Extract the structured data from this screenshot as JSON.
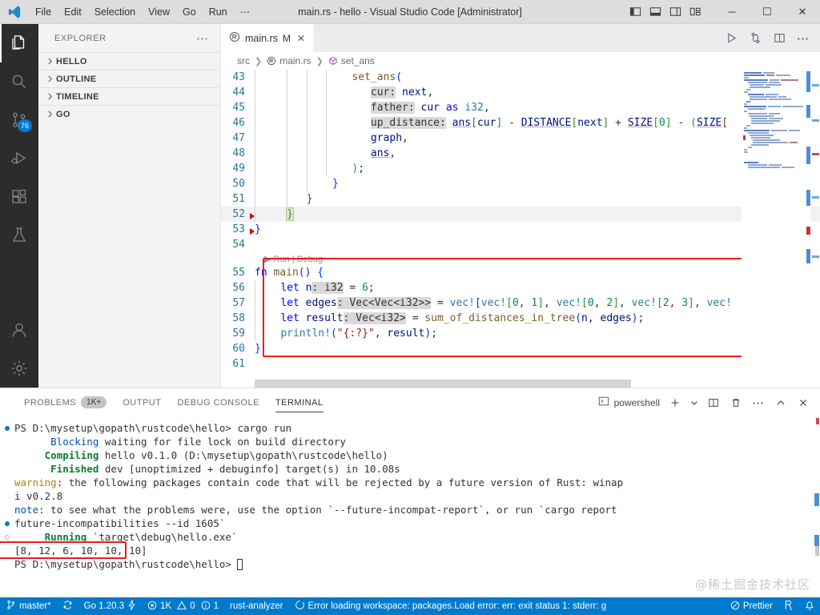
{
  "titlebar": {
    "title": "main.rs - hello - Visual Studio Code [Administrator]",
    "menu": [
      "File",
      "Edit",
      "Selection",
      "View",
      "Go",
      "Run",
      "⋯"
    ],
    "layout_icons": [
      "toggle-primary-sidebar-icon",
      "toggle-panel-icon",
      "toggle-secondary-sidebar-icon",
      "customize-layout-icon"
    ],
    "window_controls": {
      "minimize": "─",
      "maximize": "☐",
      "close": "✕"
    }
  },
  "activitybar": {
    "items": [
      {
        "name": "explorer",
        "badge": ""
      },
      {
        "name": "search",
        "badge": ""
      },
      {
        "name": "source-control",
        "badge": "76"
      },
      {
        "name": "run-and-debug",
        "badge": ""
      },
      {
        "name": "extensions",
        "badge": ""
      },
      {
        "name": "testing",
        "badge": ""
      }
    ],
    "bottom": [
      {
        "name": "accounts"
      },
      {
        "name": "settings"
      }
    ]
  },
  "sidebar": {
    "header": "EXPLORER",
    "more_label": "⋯",
    "sections": [
      {
        "label": "HELLO",
        "expanded": false
      },
      {
        "label": "OUTLINE",
        "expanded": false
      },
      {
        "label": "TIMELINE",
        "expanded": false
      },
      {
        "label": "GO",
        "expanded": false
      }
    ]
  },
  "editor": {
    "tab": {
      "label": "main.rs",
      "dirty_indicator": "M",
      "close": "✕"
    },
    "actions": [
      "run-code-icon",
      "split-changes-icon",
      "split-editor-icon",
      "more-actions-icon"
    ],
    "breadcrumb": [
      "src",
      "main.rs",
      "set_ans"
    ],
    "codelens": "▶ Run | Debug",
    "first_line_number": 43,
    "lines": [
      {
        "n": 43,
        "text": "            set_ans("
      },
      {
        "n": 44,
        "text": "                cur: next,"
      },
      {
        "n": 45,
        "text": "                father: cur as i32,"
      },
      {
        "n": 46,
        "text": "                up_distance: ans[cur] - DISTANCE[next] + SIZE[0] - (SIZE["
      },
      {
        "n": 47,
        "text": "                graph,"
      },
      {
        "n": 48,
        "text": "                ans,"
      },
      {
        "n": 49,
        "text": "            );"
      },
      {
        "n": 50,
        "text": "        }"
      },
      {
        "n": 51,
        "text": "    }"
      },
      {
        "n": 52,
        "text": "}"
      },
      {
        "n": 53,
        "text": "}"
      },
      {
        "n": 54,
        "text": ""
      },
      {
        "n": 55,
        "text": "fn main() {"
      },
      {
        "n": 56,
        "text": "    let n: i32 = 6;"
      },
      {
        "n": 57,
        "text": "    let edges: Vec<Vec<i32>> = vec![vec![0, 1], vec![0, 2], vec![2, 3], vec!"
      },
      {
        "n": 58,
        "text": "    let result: Vec<i32> = sum_of_distances_in_tree(n, edges);"
      },
      {
        "n": 59,
        "text": "    println!(\"{:?}\", result);"
      },
      {
        "n": 60,
        "text": "}"
      },
      {
        "n": 61,
        "text": ""
      }
    ],
    "highlight_box_color": "#ef1b1b"
  },
  "panel": {
    "tabs": [
      {
        "label": "PROBLEMS",
        "badge": "1K+",
        "active": false
      },
      {
        "label": "OUTPUT",
        "badge": "",
        "active": false
      },
      {
        "label": "DEBUG CONSOLE",
        "badge": "",
        "active": false
      },
      {
        "label": "TERMINAL",
        "badge": "",
        "active": true
      }
    ],
    "terminal_selector": "powershell",
    "actions": [
      "new-terminal-icon",
      "terminal-dropdown-icon",
      "split-terminal-icon",
      "kill-terminal-icon",
      "more-actions-icon",
      "maximize-panel-icon",
      "close-panel-icon"
    ],
    "terminal_lines": [
      {
        "segments": [
          {
            "t": "PS D:\\mysetup\\gopath\\rustcode\\hello> cargo run",
            "c": "plain"
          }
        ],
        "dot": "solid"
      },
      {
        "segments": [
          {
            "t": "      ",
            "c": "plain"
          },
          {
            "t": "Blocking",
            "c": "blue"
          },
          {
            "t": " waiting for file lock on build directory",
            "c": "plain"
          }
        ],
        "dot": ""
      },
      {
        "segments": [
          {
            "t": "     ",
            "c": "plain"
          },
          {
            "t": "Compiling",
            "c": "green"
          },
          {
            "t": " hello v0.1.0 (D:\\mysetup\\gopath\\rustcode\\hello)",
            "c": "plain"
          }
        ],
        "dot": ""
      },
      {
        "segments": [
          {
            "t": "      ",
            "c": "plain"
          },
          {
            "t": "Finished",
            "c": "green"
          },
          {
            "t": " dev [unoptimized + debuginfo] target(s) in 10.08s",
            "c": "plain"
          }
        ],
        "dot": ""
      },
      {
        "segments": [
          {
            "t": "warning",
            "c": "warn"
          },
          {
            "t": ": the following packages contain code that will be rejected by a future version of Rust: winap",
            "c": "plain"
          }
        ],
        "dot": ""
      },
      {
        "segments": [
          {
            "t": "i v0.2.8",
            "c": "plain"
          }
        ],
        "dot": ""
      },
      {
        "segments": [
          {
            "t": "note",
            "c": "note"
          },
          {
            "t": ": to see what the problems were, use the option `--future-incompat-report`, or run `cargo report",
            "c": "plain"
          }
        ],
        "dot": ""
      },
      {
        "segments": [
          {
            "t": "future-incompatibilities --id 1605`",
            "c": "plain"
          }
        ],
        "dot": "solid"
      },
      {
        "segments": [
          {
            "t": "     ",
            "c": "plain"
          },
          {
            "t": "Running",
            "c": "green"
          },
          {
            "t": " `target\\debug\\hello.exe`",
            "c": "plain"
          }
        ],
        "dot": "hollow"
      },
      {
        "segments": [
          {
            "t": "[8, 12, 6, 10, 10, 10]",
            "c": "plain"
          }
        ],
        "dot": ""
      },
      {
        "segments": [
          {
            "t": "PS D:\\mysetup\\gopath\\rustcode\\hello> ",
            "c": "plain"
          },
          {
            "t": "█",
            "c": "cursor"
          }
        ],
        "dot": ""
      }
    ],
    "watermark": "@稀土掘金技术社区"
  },
  "statusbar": {
    "background": "#007acc",
    "left": [
      {
        "name": "remote-branch",
        "icon": "source-control-icon",
        "label": "master*"
      },
      {
        "name": "sync-changes",
        "icon": "sync-icon",
        "label": ""
      },
      {
        "name": "go-version",
        "icon": "",
        "label": "Go 1.20.3"
      },
      {
        "name": "go-lightning",
        "icon": "lightning-icon",
        "label": ""
      },
      {
        "name": "problems",
        "icon": "error-icon",
        "label": "1K"
      },
      {
        "name": "warnings",
        "icon": "warning-icon",
        "label": "0"
      },
      {
        "name": "infos",
        "icon": "info-icon",
        "label": "1"
      },
      {
        "name": "rust-analyzer",
        "icon": "",
        "label": "rust-analyzer"
      },
      {
        "name": "workspace-error",
        "icon": "loading-icon",
        "label": "Error loading workspace: packages.Load error: err: exit status 1: stderr: g"
      }
    ],
    "right": [
      {
        "name": "prettier",
        "icon": "prohibited-icon",
        "label": "Prettier"
      },
      {
        "name": "radon-icon",
        "icon": "radon-icon",
        "label": ""
      },
      {
        "name": "notifications",
        "icon": "bell-icon",
        "label": ""
      }
    ]
  }
}
